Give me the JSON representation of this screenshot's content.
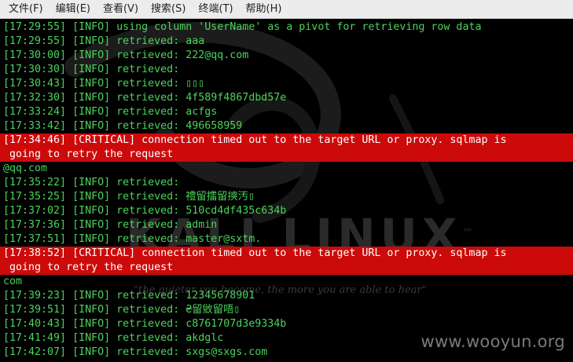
{
  "menu": [
    "文件(F)",
    "编辑(E)",
    "查看(V)",
    "搜索(S)",
    "终端(T)",
    "帮助(H)"
  ],
  "watermark": "www.wooyun.org",
  "background": {
    "logo_text": "KALI LINUX",
    "trademark": "™",
    "tagline": "\"the quieter you become, the more you are able to hear\""
  },
  "colors": {
    "terminal_bg": "#000000",
    "text_green": "#4bd35b",
    "critical_bg": "#cc0a0a"
  },
  "lines": [
    {
      "type": "info",
      "ts": "[17:29:55]",
      "level": "[INFO]",
      "msg": "using column 'UserName' as a pivot for retrieving row data"
    },
    {
      "type": "info",
      "ts": "[17:29:55]",
      "level": "[INFO]",
      "msg": "retrieved: aaa"
    },
    {
      "type": "info",
      "ts": "[17:30:00]",
      "level": "[INFO]",
      "msg": "retrieved: 222@qq.com"
    },
    {
      "type": "info",
      "ts": "[17:30:30]",
      "level": "[INFO]",
      "msg": "retrieved:"
    },
    {
      "type": "info",
      "ts": "[17:30:43]",
      "level": "[INFO]",
      "msg": "retrieved: ▯▯▯"
    },
    {
      "type": "info",
      "ts": "[17:32:30]",
      "level": "[INFO]",
      "msg": "retrieved: 4f589f4867dbd57e"
    },
    {
      "type": "info",
      "ts": "[17:33:24]",
      "level": "[INFO]",
      "msg": "retrieved: acfgs"
    },
    {
      "type": "info",
      "ts": "[17:33:42]",
      "level": "[INFO]",
      "msg": "retrieved: 496658959"
    },
    {
      "type": "crit",
      "ts": "[17:34:46]",
      "level": "[CRITICAL]",
      "msg": "connection timed out to the target URL or proxy. sqlmap is"
    },
    {
      "type": "crit",
      "ts": "",
      "level": "",
      "msg": "going to retry the request"
    },
    {
      "type": "plain",
      "ts": "",
      "level": "",
      "msg": "@qq.com"
    },
    {
      "type": "info",
      "ts": "[17:35:22]",
      "level": "[INFO]",
      "msg": "retrieved:"
    },
    {
      "type": "info",
      "ts": "[17:35:25]",
      "level": "[INFO]",
      "msg": "retrieved: 禮留擂留摤汚▯"
    },
    {
      "type": "info",
      "ts": "[17:37:02]",
      "level": "[INFO]",
      "msg": "retrieved: 510cd4df435c634b"
    },
    {
      "type": "info",
      "ts": "[17:37:36]",
      "level": "[INFO]",
      "msg": "retrieved: admin"
    },
    {
      "type": "info",
      "ts": "[17:37:51]",
      "level": "[INFO]",
      "msg": "retrieved: master@sxtm."
    },
    {
      "type": "crit",
      "ts": "[17:38:52]",
      "level": "[CRITICAL]",
      "msg": "connection timed out to the target URL or proxy. sqlmap is"
    },
    {
      "type": "crit",
      "ts": "",
      "level": "",
      "msg": "going to retry the request"
    },
    {
      "type": "plain",
      "ts": "",
      "level": "",
      "msg": "com"
    },
    {
      "type": "info",
      "ts": "[17:39:23]",
      "level": "[INFO]",
      "msg": "retrieved: 12345678901"
    },
    {
      "type": "info",
      "ts": "[17:39:51]",
      "level": "[INFO]",
      "msg": "retrieved: ₴留敓留唔▯"
    },
    {
      "type": "info",
      "ts": "[17:40:43]",
      "level": "[INFO]",
      "msg": "retrieved: c8761707d3e9334b"
    },
    {
      "type": "info",
      "ts": "[17:41:49]",
      "level": "[INFO]",
      "msg": "retrieved: akdglc"
    },
    {
      "type": "info",
      "ts": "[17:42:07]",
      "level": "[INFO]",
      "msg": "retrieved: sxgs@sxgs.com"
    }
  ]
}
